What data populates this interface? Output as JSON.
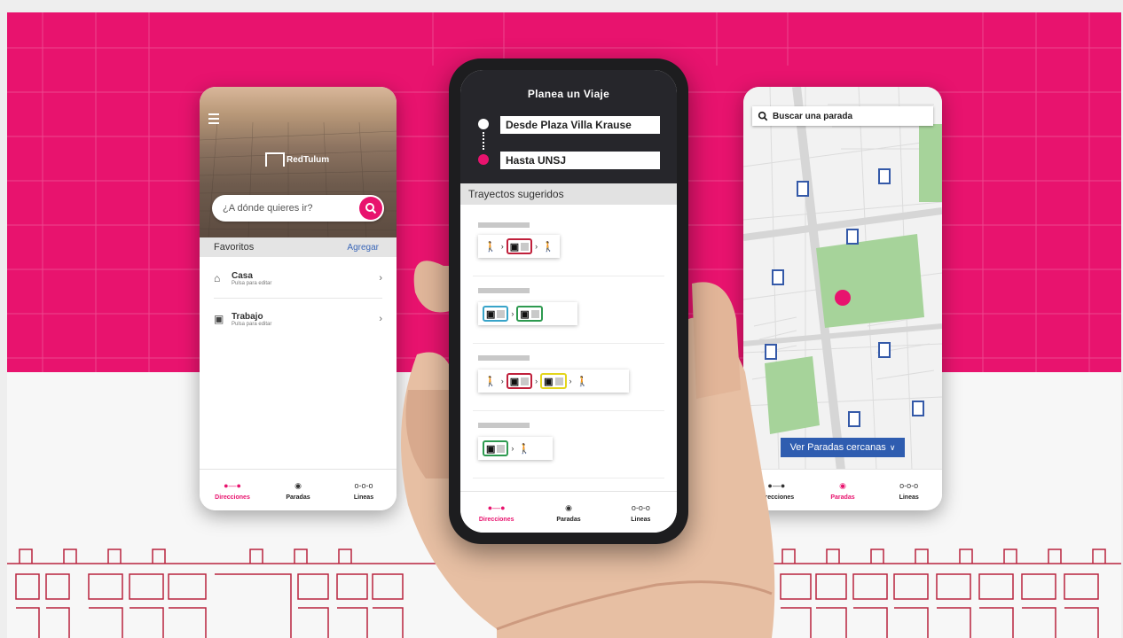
{
  "colors": {
    "brand_pink": "#e8136e",
    "dark_header": "#26262b",
    "link_blue": "#3b67b8",
    "button_blue": "#2f5db0",
    "route_red": "#c0203b",
    "route_blue": "#38a4c9",
    "route_green": "#2e9a50",
    "route_yellow": "#e3d51d"
  },
  "left_phone": {
    "logo_text": "RedTulum",
    "search_placeholder": "¿A dónde quieres ir?",
    "favorites_title": "Favoritos",
    "favorites_add": "Agregar",
    "favorites": [
      {
        "name": "Casa",
        "hint": "Pulsa para editar",
        "icon": "home-icon"
      },
      {
        "name": "Trabajo",
        "hint": "Pulsa para editar",
        "icon": "briefcase-icon"
      }
    ]
  },
  "center_phone": {
    "title": "Planea un Viaje",
    "from_value": "Desde Plaza Villa Krause",
    "to_value": "Hasta UNSJ",
    "suggested_title": "Trayectos sugeridos",
    "routes": [
      {
        "steps": [
          "walk",
          "bus-red",
          "walk"
        ]
      },
      {
        "steps": [
          "bus-blue",
          "bus-green"
        ]
      },
      {
        "steps": [
          "walk",
          "bus-red",
          "bus-yellow",
          "walk"
        ]
      },
      {
        "steps": [
          "bus-green",
          "walk"
        ]
      }
    ]
  },
  "right_phone": {
    "search_placeholder": "Buscar una parada",
    "nearby_button": "Ver Paradas cercanas",
    "bus_stop_icon": "bus-stop-icon",
    "location_icon": "location-pin-icon"
  },
  "bottom_nav": {
    "left": [
      {
        "label": "Direcciones",
        "icon": "directions-icon",
        "active": true
      },
      {
        "label": "Paradas",
        "icon": "stop-icon",
        "active": false
      },
      {
        "label": "Lineas",
        "icon": "lines-icon",
        "active": false
      }
    ],
    "center": [
      {
        "label": "Direcciones",
        "icon": "directions-icon",
        "active": true
      },
      {
        "label": "Paradas",
        "icon": "stop-icon",
        "active": false
      },
      {
        "label": "Lineas",
        "icon": "lines-icon",
        "active": false
      }
    ],
    "right": [
      {
        "label": "Direcciones",
        "icon": "directions-icon",
        "active": false
      },
      {
        "label": "Paradas",
        "icon": "stop-icon",
        "active": true
      },
      {
        "label": "Lineas",
        "icon": "lines-icon",
        "active": false
      }
    ]
  }
}
